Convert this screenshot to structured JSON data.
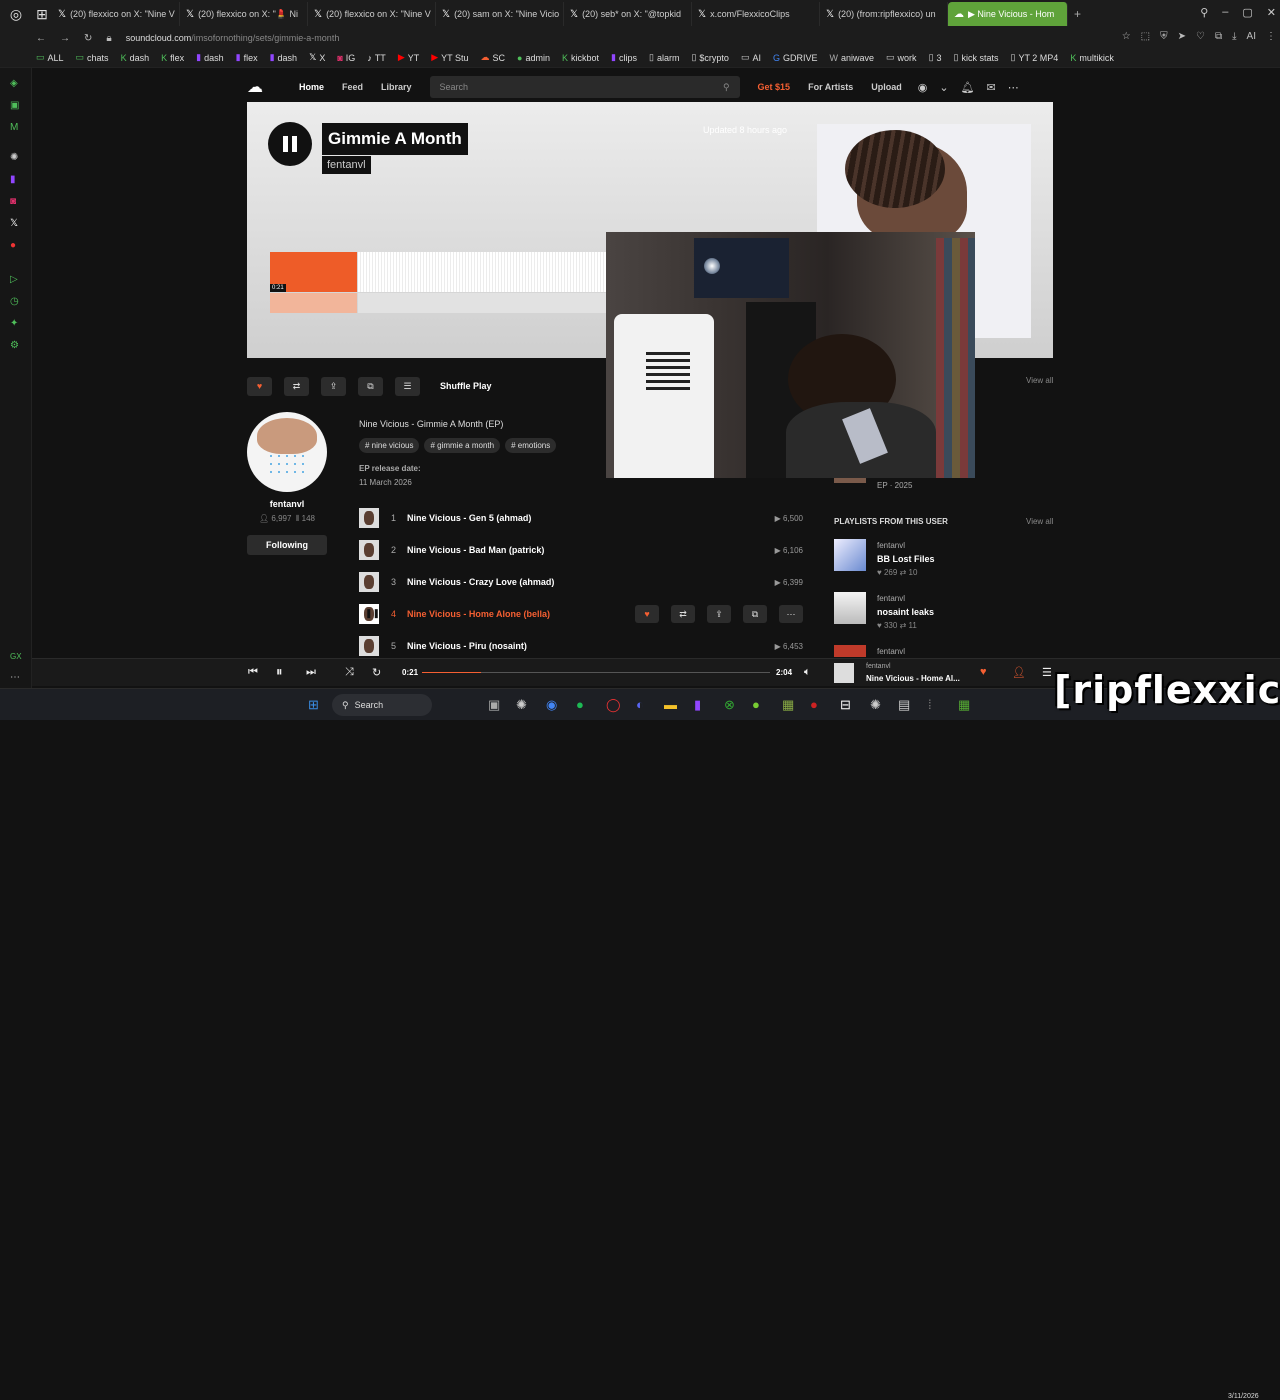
{
  "browser": {
    "tabs": [
      {
        "label": "(20) flexxico on X: \"Nine V",
        "icon": "x-icon"
      },
      {
        "label": "(20) flexxico on X: \"💄 Ni",
        "icon": "x-icon"
      },
      {
        "label": "(20) flexxico on X: \"Nine V",
        "icon": "x-icon"
      },
      {
        "label": "(20) sam on X: \"Nine Vicio",
        "icon": "x-icon"
      },
      {
        "label": "(20) seb* on X: \"@topkid",
        "icon": "x-icon"
      },
      {
        "label": "x.com/FlexxicoClips",
        "icon": "x-icon"
      },
      {
        "label": "(20) (from:ripflexxico) un",
        "icon": "x-icon"
      }
    ],
    "active_tab": {
      "label": "▶ Nine Vicious - Hom",
      "icon": "soundcloud-icon"
    },
    "new_tab": "+",
    "url_host": "soundcloud.com",
    "url_path": "/imsofornothing/sets/gimmie-a-month",
    "bookmarks": [
      "ALL",
      "chats",
      "dash",
      "flex",
      "dash",
      "flex",
      "dash",
      "X",
      "IG",
      "TT",
      "YT",
      "YT Stu",
      "SC",
      "admin",
      "kickbot",
      "clips",
      "alarm",
      "$crypto",
      "AI",
      "GDRIVE",
      "aniwave",
      "work",
      "3",
      "kick stats",
      "YT 2 MP4",
      "multikick"
    ],
    "sidebar_label": "GX"
  },
  "sc": {
    "nav": {
      "home": "Home",
      "feed": "Feed",
      "library": "Library",
      "search_placeholder": "Search",
      "get": "Get $15",
      "for_artists": "For Artists",
      "upload": "Upload"
    },
    "hero": {
      "title": "Gimmie A Month",
      "artist": "fentanvl",
      "updated": "Updated 8 hours ago",
      "wave_time": "0:21",
      "played_fraction": 0.17
    },
    "actions": {
      "shuffle": "Shuffle Play",
      "view_all": "View all"
    },
    "user": {
      "name": "fentanvl",
      "followers": "6,997",
      "tracks": "148",
      "follow": "Following"
    },
    "description": "Nine Vicious - Gimmie A Month (EP)",
    "tags": [
      "# nine vicious",
      "# gimmie a month",
      "# emotions"
    ],
    "release_label": "EP release date:",
    "release_date": "11 March 2026",
    "tracks": [
      {
        "num": "1",
        "name": "Nine Vicious - Gen 5 (ahmad)",
        "plays": "6,500"
      },
      {
        "num": "2",
        "name": "Nine Vicious - Bad Man (patrick)",
        "plays": "6,106"
      },
      {
        "num": "3",
        "name": "Nine Vicious - Crazy Love (ahmad)",
        "plays": "6,399"
      },
      {
        "num": "4",
        "name": "Nine Vicious - Home Alone (bella)",
        "plays": ""
      },
      {
        "num": "5",
        "name": "Nine Vicious - Piru (nosaint)",
        "plays": "6,453"
      }
    ],
    "right": {
      "ep_year": "EP · 2025",
      "playlists_head": "PLAYLISTS FROM THIS USER",
      "view_all": "View all",
      "playlists": [
        {
          "user": "fentanvl",
          "title": "BB Lost Files",
          "likes": "269",
          "reposts": "10"
        },
        {
          "user": "fentanvl",
          "title": "nosaint leaks",
          "likes": "330",
          "reposts": "11"
        },
        {
          "user": "fentanvl",
          "title": "",
          "likes": "",
          "reposts": ""
        }
      ]
    },
    "player": {
      "elapsed": "0:21",
      "duration": "2:04",
      "progress": 0.17,
      "user": "fentanvl",
      "title": "Nine Vicious - Home Al..."
    }
  },
  "taskbar": {
    "search": "Search",
    "date": "3/11/2026"
  },
  "watermark": "[ripflexxico]",
  "colors": {
    "accent": "#f55f32",
    "browser_green": "#5fa33a",
    "bg": "#121212"
  }
}
